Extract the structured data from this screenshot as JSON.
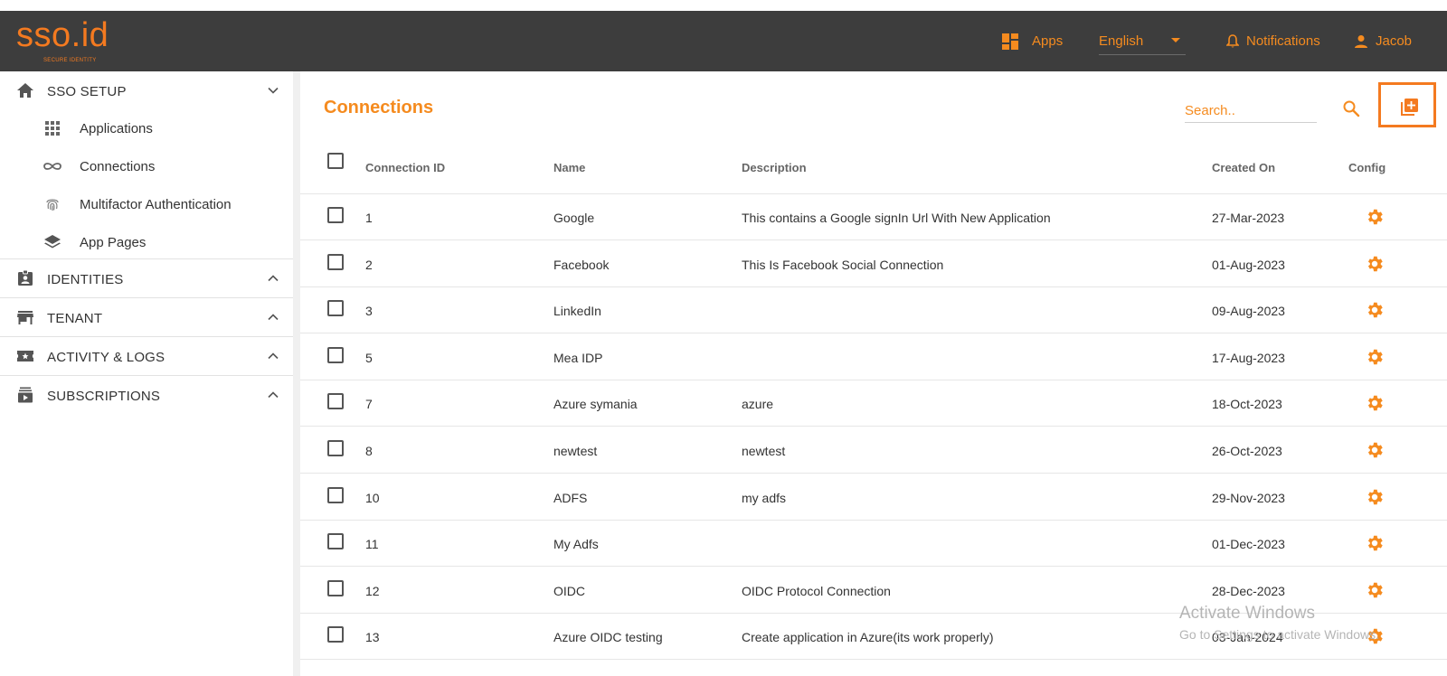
{
  "header": {
    "logo_text": "sso.id",
    "logo_sub": "SECURE IDENTITY",
    "apps_label": "Apps",
    "language": "English",
    "notifications_label": "Notifications",
    "user_name": "Jacob"
  },
  "sidebar": {
    "sections": [
      {
        "label": "SSO SETUP",
        "icon": "home-icon",
        "expanded": true
      },
      {
        "label": "IDENTITIES",
        "icon": "badge-icon",
        "expanded": false
      },
      {
        "label": "TENANT",
        "icon": "store-icon",
        "expanded": false
      },
      {
        "label": "ACTIVITY & LOGS",
        "icon": "ticket-icon",
        "expanded": false
      },
      {
        "label": "SUBSCRIPTIONS",
        "icon": "subscriptions-icon",
        "expanded": false
      }
    ],
    "sso_items": [
      {
        "label": "Applications",
        "icon": "grid-icon"
      },
      {
        "label": "Connections",
        "icon": "infinity-icon"
      },
      {
        "label": "Multifactor Authentication",
        "icon": "fingerprint-icon"
      },
      {
        "label": "App Pages",
        "icon": "layers-icon"
      }
    ]
  },
  "main": {
    "title": "Connections",
    "search_placeholder": "Search..",
    "columns": [
      "Connection ID",
      "Name",
      "Description",
      "Created On",
      "Config"
    ],
    "rows": [
      {
        "id": "1",
        "name": "Google",
        "description": "This contains a Google signIn Url With New Application",
        "created": "27-Mar-2023"
      },
      {
        "id": "2",
        "name": "Facebook",
        "description": "This Is Facebook Social Connection",
        "created": "01-Aug-2023"
      },
      {
        "id": "3",
        "name": "LinkedIn",
        "description": "",
        "created": "09-Aug-2023"
      },
      {
        "id": "5",
        "name": "Mea IDP",
        "description": "",
        "created": "17-Aug-2023"
      },
      {
        "id": "7",
        "name": "Azure symania",
        "description": "azure",
        "created": "18-Oct-2023"
      },
      {
        "id": "8",
        "name": "newtest",
        "description": "newtest",
        "created": "26-Oct-2023"
      },
      {
        "id": "10",
        "name": "ADFS",
        "description": "my adfs",
        "created": "29-Nov-2023"
      },
      {
        "id": "11",
        "name": "My Adfs",
        "description": "",
        "created": "01-Dec-2023"
      },
      {
        "id": "12",
        "name": "OIDC",
        "description": "OIDC Protocol Connection",
        "created": "28-Dec-2023"
      },
      {
        "id": "13",
        "name": "Azure OIDC testing",
        "description": "Create application in Azure(its work properly)",
        "created": "03-Jan-2024"
      }
    ]
  },
  "watermark": {
    "line1": "Activate Windows",
    "line2": "Go to Settings to activate Windows."
  },
  "colors": {
    "accent": "#f58b1f",
    "header_bg": "#3d3d3d"
  }
}
